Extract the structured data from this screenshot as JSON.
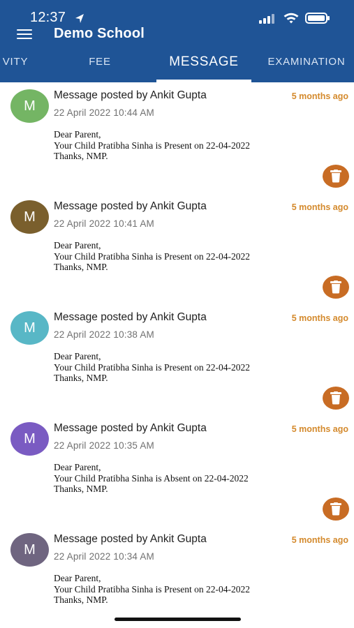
{
  "status_bar": {
    "time": "12:37",
    "icons": [
      "location-arrow-icon",
      "signal-icon",
      "wifi-icon",
      "battery-icon"
    ]
  },
  "header": {
    "menu_icon": "hamburger-menu-icon",
    "title": "Demo School",
    "background_color": "#1f5496"
  },
  "tabs": [
    {
      "label": "VITY",
      "active": false
    },
    {
      "label": "FEE",
      "active": false
    },
    {
      "label": "MESSAGE",
      "active": true
    },
    {
      "label": "EXAMINATION",
      "active": false
    }
  ],
  "messages": [
    {
      "avatar_letter": "M",
      "avatar_color": "#74b564",
      "title": "Message posted by Ankit Gupta",
      "time_ago": "5 months ago",
      "date": "22 April 2022 10:44 AM",
      "body_lines": [
        "Dear Parent,",
        "Your Child Pratibha Sinha is Present on 22-04-2022",
        "Thanks, NMP."
      ],
      "delete_icon": "trash-icon"
    },
    {
      "avatar_letter": "M",
      "avatar_color": "#7a5f2d",
      "title": "Message posted by Ankit Gupta",
      "time_ago": "5 months ago",
      "date": "22 April 2022 10:41 AM",
      "body_lines": [
        "Dear Parent,",
        "Your Child Pratibha Sinha is Present on 22-04-2022",
        "Thanks, NMP."
      ],
      "delete_icon": "trash-icon"
    },
    {
      "avatar_letter": "M",
      "avatar_color": "#58b7c6",
      "title": "Message posted by Ankit Gupta",
      "time_ago": "5 months ago",
      "date": "22 April 2022 10:38 AM",
      "body_lines": [
        "Dear Parent,",
        "Your Child Pratibha Sinha is Present on 22-04-2022",
        "Thanks, NMP."
      ],
      "delete_icon": "trash-icon"
    },
    {
      "avatar_letter": "M",
      "avatar_color": "#7a5bc2",
      "title": "Message posted by Ankit Gupta",
      "time_ago": "5 months ago",
      "date": "22 April 2022 10:35 AM",
      "body_lines": [
        "Dear Parent,",
        "Your Child Pratibha Sinha is Absent on 22-04-2022",
        "Thanks, NMP."
      ],
      "delete_icon": "trash-icon"
    },
    {
      "avatar_letter": "M",
      "avatar_color": "#6f6580",
      "title": "Message posted by Ankit Gupta",
      "time_ago": "5 months ago",
      "date": "22 April 2022 10:34 AM",
      "body_lines": [
        "Dear Parent,",
        "Your Child Pratibha Sinha is Present on 22-04-2022",
        "Thanks, NMP."
      ],
      "delete_icon": "trash-icon"
    }
  ],
  "colors": {
    "accent": "#1f5496",
    "time_ago": "#d48a2d",
    "delete_button": "#c86c24"
  }
}
